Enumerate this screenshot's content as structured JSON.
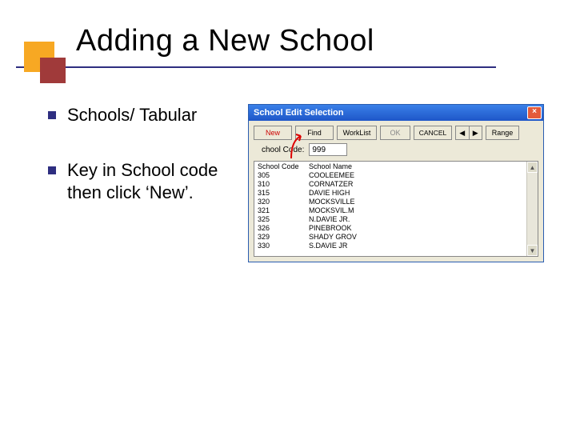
{
  "title": "Adding a New School",
  "bullets": [
    "Schools/ Tabular",
    "Key in School code then click ‘New’."
  ],
  "window": {
    "title": "School Edit Selection",
    "close": "×",
    "buttons": {
      "new": "New",
      "find": "Find",
      "worklist": "WorkList",
      "ok": "OK",
      "cancel": "CANCEL",
      "range": "Range",
      "nav_left": "◀",
      "nav_right": "▶"
    },
    "field": {
      "label": "chool Code:",
      "value": "999"
    },
    "columns": {
      "code": "School Code",
      "name": "School Name"
    },
    "rows": [
      {
        "code": "305",
        "name": "COOLEEMEE"
      },
      {
        "code": "310",
        "name": "CORNATZER"
      },
      {
        "code": "315",
        "name": "DAVIE HIGH"
      },
      {
        "code": "320",
        "name": "MOCKSVILLE"
      },
      {
        "code": "321",
        "name": "MOCKSVIL.M"
      },
      {
        "code": "325",
        "name": "N.DAVIE JR."
      },
      {
        "code": "326",
        "name": "PINEBROOK"
      },
      {
        "code": "329",
        "name": "SHADY GROV"
      },
      {
        "code": "330",
        "name": "S.DAVIE JR"
      }
    ],
    "scroll_up": "▲",
    "scroll_down": "▼"
  }
}
